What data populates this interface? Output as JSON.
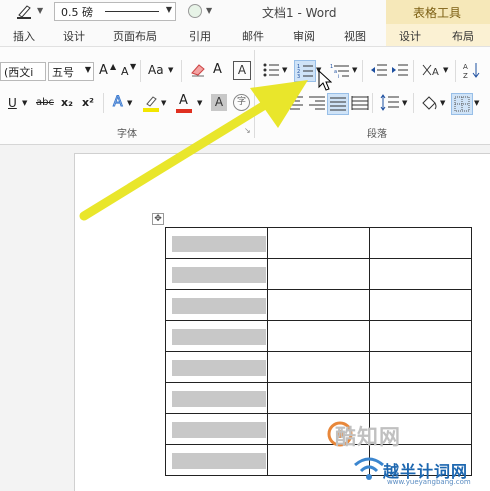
{
  "titlebar": {
    "line_weight": "0.5 磅",
    "doc_title": "文档1 - Word",
    "table_tools": "表格工具"
  },
  "tabs": [
    "插入",
    "设计",
    "页面布局",
    "引用",
    "邮件",
    "审阅",
    "视图",
    "设计",
    "布局"
  ],
  "ribbon": {
    "font_name": "(西文i",
    "font_size": "五号",
    "grow_font": "A",
    "shrink_font": "A",
    "change_case": "Aa",
    "phonetic": "A",
    "underline": "U",
    "strikethrough": "abc",
    "subscript": "x₂",
    "superscript": "x²",
    "text_effects": "A",
    "font_color": "A",
    "char_shading": "A",
    "enclose": "字",
    "font_group_label": "字体",
    "paragraph_group_label": "段落",
    "accent_yellow": "#f2e600",
    "accent_red": "#e03020"
  },
  "watermark": {
    "site_cn": "酷知网",
    "brand": "越半计词网",
    "url": "www.yueyangbang.com"
  },
  "table": {
    "rows": 8,
    "cols": 3
  }
}
